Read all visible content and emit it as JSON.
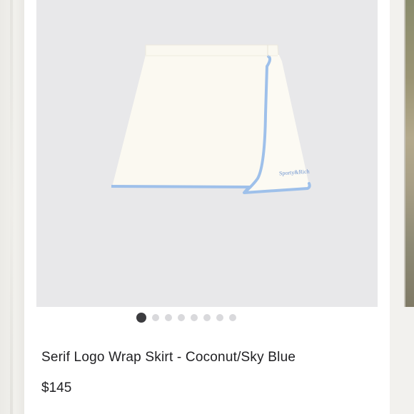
{
  "product": {
    "title": "Serif Logo Wrap Skirt - Coconut/Sky Blue",
    "price": "$145",
    "logo_text": "Sporty&Rich",
    "colors": {
      "fabric": "#fbf9f1",
      "trim": "#9ec0ea",
      "logo": "#6d93cf",
      "background": "#e8e8ea"
    }
  },
  "gallery": {
    "total_images": 8,
    "active_index": 0
  }
}
